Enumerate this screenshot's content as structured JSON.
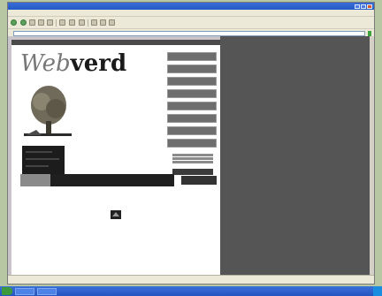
{
  "browser": {
    "title": "",
    "menu": [
      "",
      "",
      "",
      "",
      "",
      ""
    ],
    "toolbar": {
      "back": "",
      "search": "",
      "favorites": ""
    },
    "address": {
      "label": "",
      "url": "",
      "go": ""
    },
    "status": ""
  },
  "site": {
    "logo_web": "Web",
    "logo_verd": "verd",
    "top_strip_left": "",
    "top_strip_right": "",
    "nav": [
      "",
      "",
      "",
      "",
      "",
      "",
      "",
      ""
    ],
    "banner_lines": [
      "",
      ""
    ],
    "badge_small": "",
    "footer_text": "",
    "badge_label": ""
  },
  "taskbar": {
    "start": "",
    "items": [
      "",
      ""
    ],
    "clock": ""
  },
  "colors": {
    "desktop": "#b7c7a3",
    "titlebar": "#245bc5",
    "nav": "#6e6e6e",
    "dark": "#555555"
  }
}
